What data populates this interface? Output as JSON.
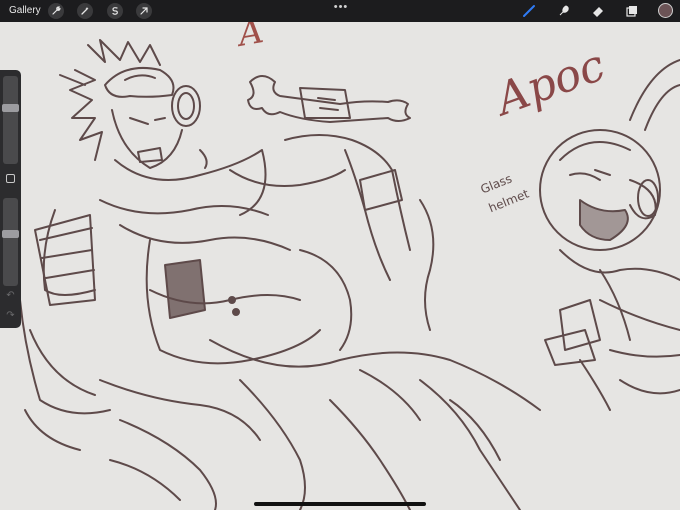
{
  "topbar": {
    "gallery_label": "Gallery",
    "left_tools": [
      "wrench-icon",
      "magic-wand-icon",
      "selection-icon",
      "transform-arrow-icon"
    ],
    "more_label": "•••",
    "right_tools": [
      "brush-icon",
      "smudge-icon",
      "eraser-icon",
      "layers-icon"
    ],
    "active_tool": "brush-icon",
    "active_color": "#6b5356",
    "accent_color": "#2f7bf6"
  },
  "sidebar": {
    "brush_size": 0.35,
    "opacity": 0.4,
    "undo_label": "↶",
    "redo_label": "↷"
  },
  "canvas": {
    "annotations": {
      "top_letter": "A",
      "top_right": "Apoc",
      "helmet_line1": "Glass",
      "helmet_line2": "helmet"
    },
    "colors": {
      "sketch_dark": "#5e4a4a",
      "sketch_red": "#a0504a",
      "background": "#e6e5e3"
    }
  }
}
